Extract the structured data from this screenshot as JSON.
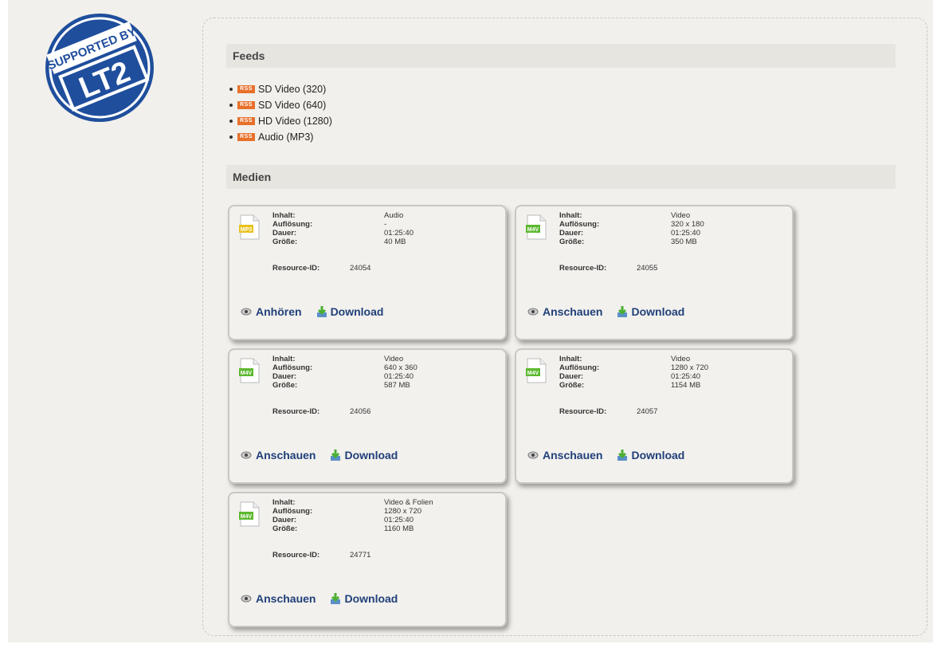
{
  "logo": {
    "text_top": "SUPPORTED BY",
    "text_bottom": "LT2"
  },
  "feeds": {
    "title": "Feeds",
    "rss_badge": "RSS",
    "items": [
      {
        "label": "SD Video (320)"
      },
      {
        "label": "SD Video (640)"
      },
      {
        "label": "HD Video (1280)"
      },
      {
        "label": "Audio (MP3)"
      }
    ]
  },
  "media": {
    "title": "Medien",
    "labels": {
      "inhalt": "Inhalt:",
      "aufloesung": "Auflösung:",
      "dauer": "Dauer:",
      "groesse": "Größe:",
      "resource_id": "Resource-ID:"
    },
    "cards": [
      {
        "type": "MP3",
        "inhalt": "Audio",
        "aufloesung": "-",
        "dauer": "01:25:40",
        "groesse": "40 MB",
        "resource_id": "24054",
        "action1": "Anhören",
        "action2": "Download"
      },
      {
        "type": "M4V",
        "inhalt": "Video",
        "aufloesung": "320 x 180",
        "dauer": "01:25:40",
        "groesse": "350 MB",
        "resource_id": "24055",
        "action1": "Anschauen",
        "action2": "Download"
      },
      {
        "type": "M4V",
        "inhalt": "Video",
        "aufloesung": "640 x 360",
        "dauer": "01:25:40",
        "groesse": "587 MB",
        "resource_id": "24056",
        "action1": "Anschauen",
        "action2": "Download"
      },
      {
        "type": "M4V",
        "inhalt": "Video",
        "aufloesung": "1280 x 720",
        "dauer": "01:25:40",
        "groesse": "1154 MB",
        "resource_id": "24057",
        "action1": "Anschauen",
        "action2": "Download"
      },
      {
        "type": "M4V",
        "inhalt": "Video & Folien",
        "aufloesung": "1280 x 720",
        "dauer": "01:25:40",
        "groesse": "1160 MB",
        "resource_id": "24771",
        "action1": "Anschauen",
        "action2": "Download"
      }
    ]
  },
  "colors": {
    "mp3": "#e8c21e",
    "m4v": "#5cb82e",
    "rss": "#e8702a",
    "link": "#21407a",
    "logo": "#1f4e9c"
  }
}
